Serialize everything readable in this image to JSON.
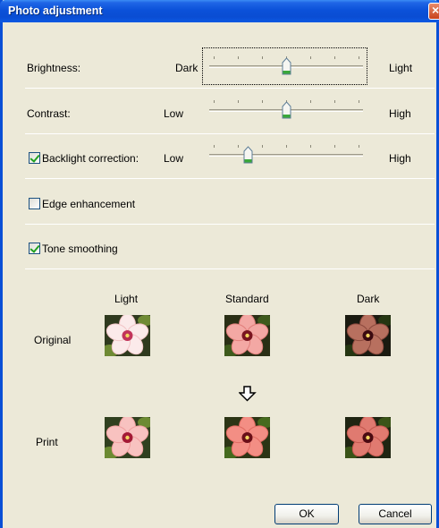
{
  "window": {
    "title": "Photo adjustment"
  },
  "sliders": [
    {
      "label": "Brightness:",
      "min_label": "Dark",
      "max_label": "Light",
      "position": 0.5
    },
    {
      "label": "Contrast:",
      "min_label": "Low",
      "max_label": "High",
      "position": 0.5
    },
    {
      "label": "Backlight correction:",
      "min_label": "Low",
      "max_label": "High",
      "position": 0.25,
      "checked": true
    }
  ],
  "checkboxes": [
    {
      "label": "Edge enhancement",
      "checked": false
    },
    {
      "label": "Tone smoothing",
      "checked": true
    }
  ],
  "preview": {
    "columns": [
      "Light",
      "Standard",
      "Dark"
    ],
    "rows": [
      "Original",
      "Print"
    ],
    "arrow_icon": "down-arrow-icon"
  },
  "buttons": {
    "ok": "OK",
    "cancel": "Cancel"
  },
  "colors": {
    "title_bar": "#0a4dd3",
    "dialog_bg": "#ece9d8",
    "check_mark": "#21a121"
  }
}
